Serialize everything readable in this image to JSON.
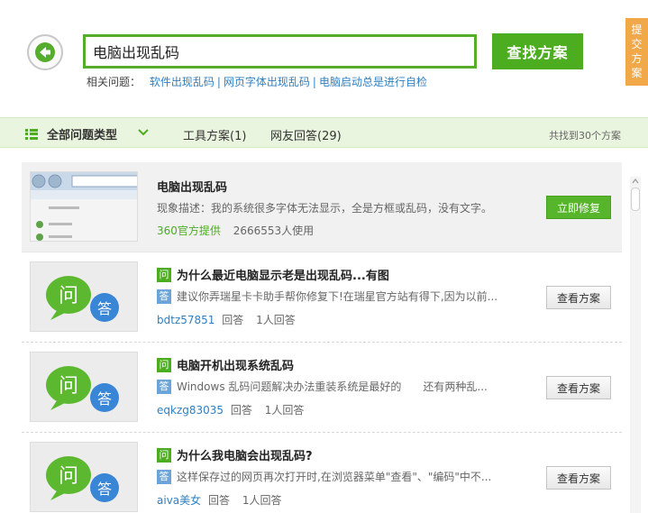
{
  "header": {
    "search_value": "电脑出现乱码",
    "search_button": "查找方案",
    "related_label": "相关问题：",
    "related_links": [
      "软件出现乱码",
      "网页字体出现乱码",
      "电脑启动总是进行自检"
    ],
    "side_tab": [
      "提",
      "交",
      "方",
      "案"
    ]
  },
  "filter": {
    "all_types": "全部问题类型",
    "tab_tools": "工具方案(1)",
    "tab_users": "网友回答(29)",
    "found": "共找到30个方案"
  },
  "results": {
    "first": {
      "title": "电脑出现乱码",
      "desc": "现象描述：我的系统很多字体无法显示，全是方框或乱码，没有文字。",
      "source": "360官方提供",
      "users": "2666553人使用",
      "button": "立即修复"
    },
    "qa": [
      {
        "q_badge": "问",
        "title": "为什么最近电脑显示老是出现乱码...有图",
        "a_badge": "答",
        "answer": "建议你弄瑞星卡卡助手帮你修复下!在瑞星官方站有得下,因为以前...",
        "user": "bdtz57851",
        "answer_label": "回答",
        "count": "1人回答",
        "button": "查看方案"
      },
      {
        "q_badge": "问",
        "title": "电脑开机出现系统乱码",
        "a_badge": "答",
        "answer": "Windows 乱码问题解决办法重装系统是最好的　　还有两种乱...",
        "user": "eqkzg83035",
        "answer_label": "回答",
        "count": "1人回答",
        "button": "查看方案"
      },
      {
        "q_badge": "问",
        "title": "为什么我电脑会出现乱码?",
        "a_badge": "答",
        "answer": "这样保存过的网页再次打开时,在浏览器菜单\"查看\"、\"编码\"中不...",
        "user": "aiva美女",
        "answer_label": "回答",
        "count": "1人回答",
        "button": "查看方案"
      }
    ]
  },
  "thumb_labels": {
    "answer_glyph": "答",
    "question_glyph": "问"
  },
  "colors": {
    "accent": "#4bad1f",
    "link": "#2f7fc1",
    "side_tab": "#f0a849",
    "answer_bubble": "#3a86d6"
  }
}
